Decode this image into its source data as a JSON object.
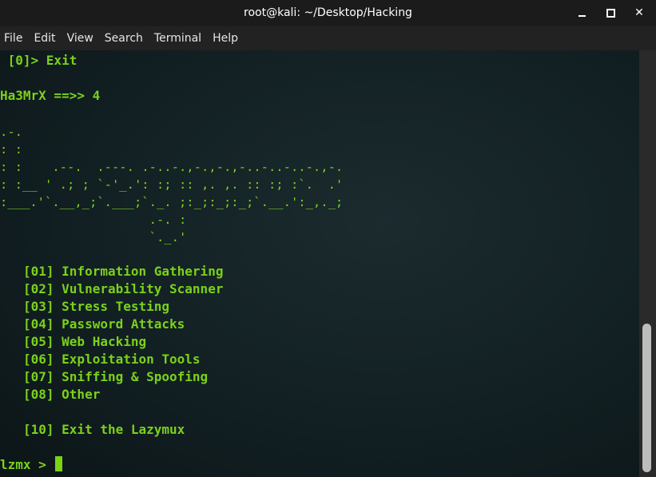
{
  "window": {
    "title": "root@kali: ~/Desktop/Hacking"
  },
  "menubar": {
    "items": [
      "File",
      "Edit",
      "View",
      "Search",
      "Terminal",
      "Help"
    ]
  },
  "terminal": {
    "lines": {
      "exit_option": " [0]> Exit",
      "prompt_input": "Ha3MrX ==>> 4",
      "art": [
        ".-.",
        ": :",
        ": :    .--.  .---. .-..-.,-.,-.,-..-..-..-.,-.",
        ": :__ ' .; ; `-'_.': :; :: ,. ,. :: :; :`.  .'",
        ":___.'`.__,_;`.___;`._. ;:_;:_;:_;`.__.':_,._;",
        "                    .-. :",
        "                    `._.'"
      ],
      "menu": [
        "[01] Information Gathering",
        "[02] Vulnerability Scanner",
        "[03] Stress Testing",
        "[04] Password Attacks",
        "[05] Web Hacking",
        "[06] Exploitation Tools",
        "[07] Sniffing & Spoofing",
        "[08] Other"
      ],
      "exit_menu": "[10] Exit the Lazymux",
      "final_prompt": "lzmx > "
    }
  },
  "colors": {
    "terminal_text": "#7bd11a",
    "titlebar_bg": "#1b1b1b",
    "menubar_bg": "#222222"
  }
}
